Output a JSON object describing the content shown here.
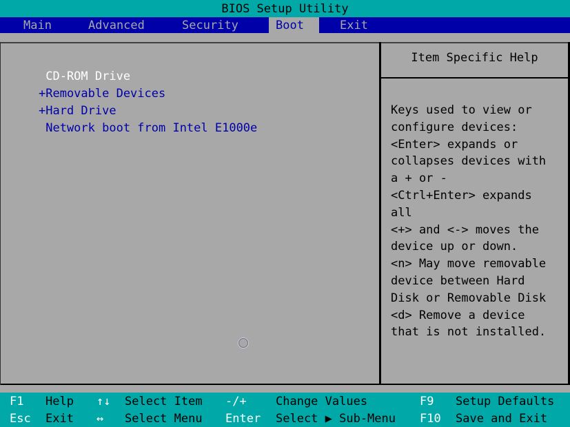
{
  "title": "BIOS Setup Utility",
  "menu": {
    "tabs": [
      {
        "label": "Main"
      },
      {
        "label": "Advanced"
      },
      {
        "label": "Security"
      },
      {
        "label": "Boot"
      },
      {
        "label": "Exit"
      }
    ],
    "active_tab": "Boot"
  },
  "boot_list": {
    "items": [
      {
        "label": " CD-ROM Drive",
        "selected": true
      },
      {
        "label": "+Removable Devices",
        "selected": false
      },
      {
        "label": "+Hard Drive",
        "selected": false
      },
      {
        "label": " Network boot from Intel E1000e",
        "selected": false
      }
    ]
  },
  "help": {
    "title": "Item Specific Help",
    "lines": [
      "Keys used to view or",
      "configure devices:",
      "<Enter> expands or",
      "collapses devices with",
      "a + or -",
      "<Ctrl+Enter> expands",
      "all",
      "<+> and <-> moves the",
      "device up or down.",
      "<n> May move removable",
      "device between Hard",
      "Disk or Removable Disk",
      "<d> Remove a device",
      "that is not installed."
    ]
  },
  "footer": {
    "row1": [
      {
        "key": "F1",
        "desc": "Help"
      },
      {
        "key": "↑↓",
        "desc": "Select Item"
      },
      {
        "key": "-/+",
        "desc": "Change Values"
      },
      {
        "key": "F9",
        "desc": "Setup Defaults"
      }
    ],
    "row2": [
      {
        "key": "Esc",
        "desc": "Exit"
      },
      {
        "key": "↔",
        "desc": "Select Menu"
      },
      {
        "key": "Enter",
        "desc": "Select ▶ Sub-Menu"
      },
      {
        "key": "F10",
        "desc": "Save and Exit"
      }
    ]
  },
  "colors": {
    "title_bg": "#00a8a8",
    "menu_bg": "#0000a8",
    "panel_bg": "#a8a8a8",
    "item_text": "#0000a8",
    "selected_text": "#ffffff",
    "footer_bg": "#00a8a8"
  }
}
